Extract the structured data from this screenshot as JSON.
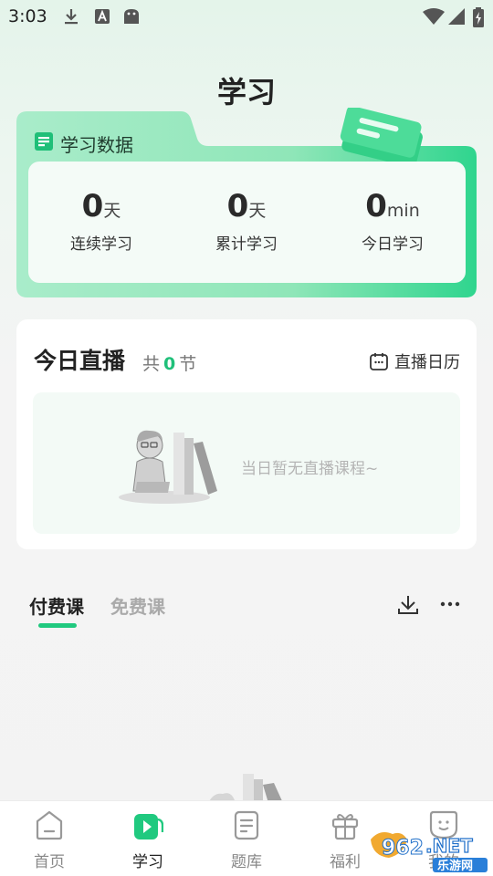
{
  "status_bar": {
    "time": "3:03"
  },
  "page": {
    "title": "学习"
  },
  "study_stats": {
    "tab_label": "学习数据",
    "items": [
      {
        "value": "0",
        "unit": "天",
        "label": "连续学习"
      },
      {
        "value": "0",
        "unit": "天",
        "label": "累计学习"
      },
      {
        "value": "0",
        "unit": "min",
        "label": "今日学习"
      }
    ]
  },
  "live": {
    "title": "今日直播",
    "count_prefix": "共",
    "count": "0",
    "count_suffix": "节",
    "calendar_label": "直播日历",
    "empty_text": "当日暂无直播课程~"
  },
  "course_tabs": {
    "paid": "付费课",
    "free": "免费课"
  },
  "bottom_nav": [
    {
      "label": "首页",
      "icon": "home-icon"
    },
    {
      "label": "学习",
      "icon": "study-play-icon"
    },
    {
      "label": "题库",
      "icon": "question-bank-icon"
    },
    {
      "label": "福利",
      "icon": "gift-icon"
    },
    {
      "label": "我的",
      "icon": "profile-face-icon"
    }
  ],
  "watermark": {
    "text": "962.NET",
    "sub": "乐游网"
  },
  "colors": {
    "accent": "#20c97f",
    "accent_light": "#9ee8c3"
  }
}
